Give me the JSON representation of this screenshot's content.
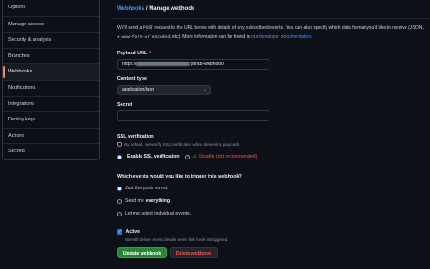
{
  "sidebar": {
    "items": [
      {
        "label": "Options"
      },
      {
        "label": "Manage access"
      },
      {
        "label": "Security & analysis"
      },
      {
        "label": "Branches"
      },
      {
        "label": "Webhooks"
      },
      {
        "label": "Notifications"
      },
      {
        "label": "Integrations"
      },
      {
        "label": "Deploy keys"
      },
      {
        "label": "Actions"
      },
      {
        "label": "Secrets"
      }
    ],
    "active_index": 4
  },
  "breadcrumb": {
    "link": "Webhooks",
    "separator": "/",
    "current": "Manage webhook"
  },
  "intro": {
    "text1": "We'll send a",
    "method": "POST",
    "text2": "request to the URL below with details of any subscribed events. You can also specify which data format you'd like to receive (JSON,",
    "format_code": "x-www-form-urlencoded",
    "text3": ", etc). More information can be found in",
    "link": "our developer documentation",
    "text4": "."
  },
  "payload_url": {
    "label": "Payload URL",
    "required_mark": "*",
    "value_prefix": "https://",
    "value_suffix": "/github-webhook/"
  },
  "content_type": {
    "label": "Content type",
    "value": "application/json"
  },
  "secret": {
    "label": "Secret",
    "value": ""
  },
  "ssl": {
    "label": "SSL verification",
    "hint": "By default, we verify SSL certificates when delivering payloads.",
    "enable_label": "Enable SSL verification",
    "disable_label": "Disable",
    "disable_note": "(not recommended)",
    "selected": "enable"
  },
  "events": {
    "label": "Which events would you like to trigger this webhook?",
    "options": [
      {
        "pre": "Just the",
        "code": "push",
        "post": "event.",
        "selected": true
      },
      {
        "pre": "Send me",
        "bold": "everything",
        "post": ".",
        "selected": false
      },
      {
        "pre": "Let me select individual events.",
        "selected": false
      }
    ]
  },
  "active": {
    "label": "Active",
    "checked": true,
    "hint": "We will deliver event details when this hook is triggered."
  },
  "buttons": {
    "update": "Update webhook",
    "delete": "Delete webhook"
  },
  "colors": {
    "accent_link": "#4493f8",
    "danger": "#f85149",
    "primary_green": "#238636",
    "active_tab_marker": "#f78166"
  }
}
